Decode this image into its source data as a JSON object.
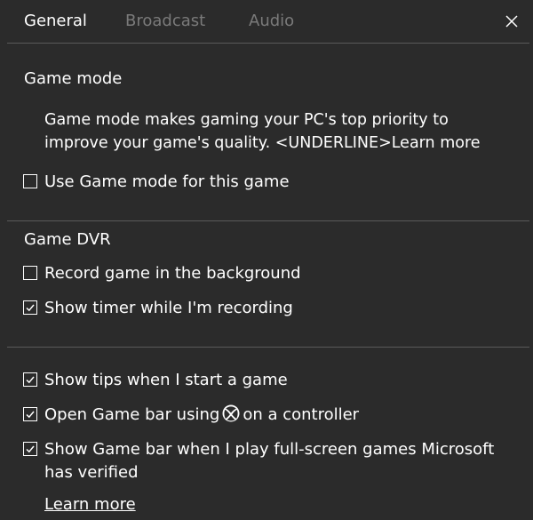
{
  "tabs": {
    "general": "General",
    "broadcast": "Broadcast",
    "audio": "Audio"
  },
  "game_mode": {
    "heading": "Game mode",
    "description": "Game mode makes gaming your PC's top priority to improve your game's quality. <UNDERLINE>Learn more",
    "use_game_mode_label": "Use Game mode for this game",
    "use_game_mode_checked": false
  },
  "game_dvr": {
    "heading": "Game DVR",
    "record_background_label": "Record game in the background",
    "record_background_checked": false,
    "show_timer_label": "Show timer while I'm recording",
    "show_timer_checked": true
  },
  "other": {
    "show_tips_label": "Show tips when I start a game",
    "show_tips_checked": true,
    "open_game_bar_prefix": "Open Game bar using",
    "open_game_bar_suffix": "on a controller",
    "open_game_bar_checked": true,
    "show_game_bar_fullscreen_label": "Show Game bar when I play full-screen games Microsoft has verified",
    "show_game_bar_fullscreen_checked": true,
    "learn_more_label": "Learn more"
  },
  "icons": {
    "close": "close-icon",
    "checkbox_check": "checkmark-icon",
    "controller_button": "xbox-logo-icon"
  },
  "colors": {
    "background": "#2b2b2b",
    "text": "#ffffff",
    "inactive_tab": "#7a7a7a",
    "divider": "#5a5a5a"
  }
}
